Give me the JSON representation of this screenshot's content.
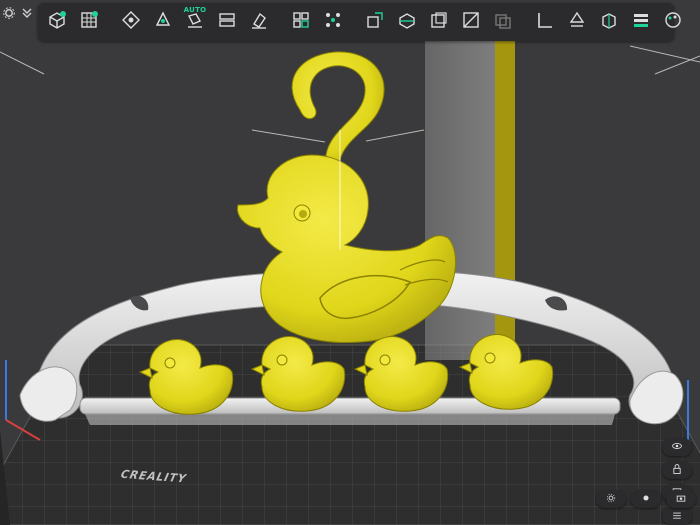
{
  "app": {
    "brand_text": "CREALITY"
  },
  "colors": {
    "accent": "#1fd19a",
    "model_yellow": "#e6dd1b",
    "model_white": "#e4e4e4",
    "toolbar_bg": "#2b2b2d",
    "viewport_bg": "#3a3a3c",
    "bed": "#2a2a2a"
  },
  "toolbar": {
    "groups": [
      [
        {
          "icon": "add-model-icon"
        },
        {
          "icon": "add-plate-icon"
        }
      ],
      [
        {
          "icon": "auto-orient-icon"
        },
        {
          "icon": "lay-on-face-icon"
        },
        {
          "icon": "auto-arrange-icon",
          "badge": "AUTO"
        },
        {
          "icon": "split-plate-icon"
        },
        {
          "icon": "erase-icon"
        }
      ],
      [
        {
          "icon": "grid-arrange-icon"
        },
        {
          "icon": "scatter-icon"
        }
      ],
      [
        {
          "icon": "scale-icon"
        },
        {
          "icon": "cut-icon"
        },
        {
          "icon": "hollow-icon"
        },
        {
          "icon": "slash-icon"
        },
        {
          "icon": "boolean-icon"
        }
      ],
      [
        {
          "icon": "measure-icon"
        },
        {
          "icon": "support-paint-icon"
        },
        {
          "icon": "seam-paint-icon"
        },
        {
          "icon": "layers-icon"
        },
        {
          "icon": "color-paint-icon"
        }
      ]
    ]
  },
  "side_controls": [
    {
      "icon": "eye-icon"
    },
    {
      "icon": "lock-icon"
    },
    {
      "icon": "view-icon"
    },
    {
      "icon": "grid-icon"
    }
  ],
  "bottom_controls": [
    {
      "icon": "settings-icon"
    },
    {
      "icon": "sun-icon"
    },
    {
      "icon": "camera-icon"
    }
  ]
}
